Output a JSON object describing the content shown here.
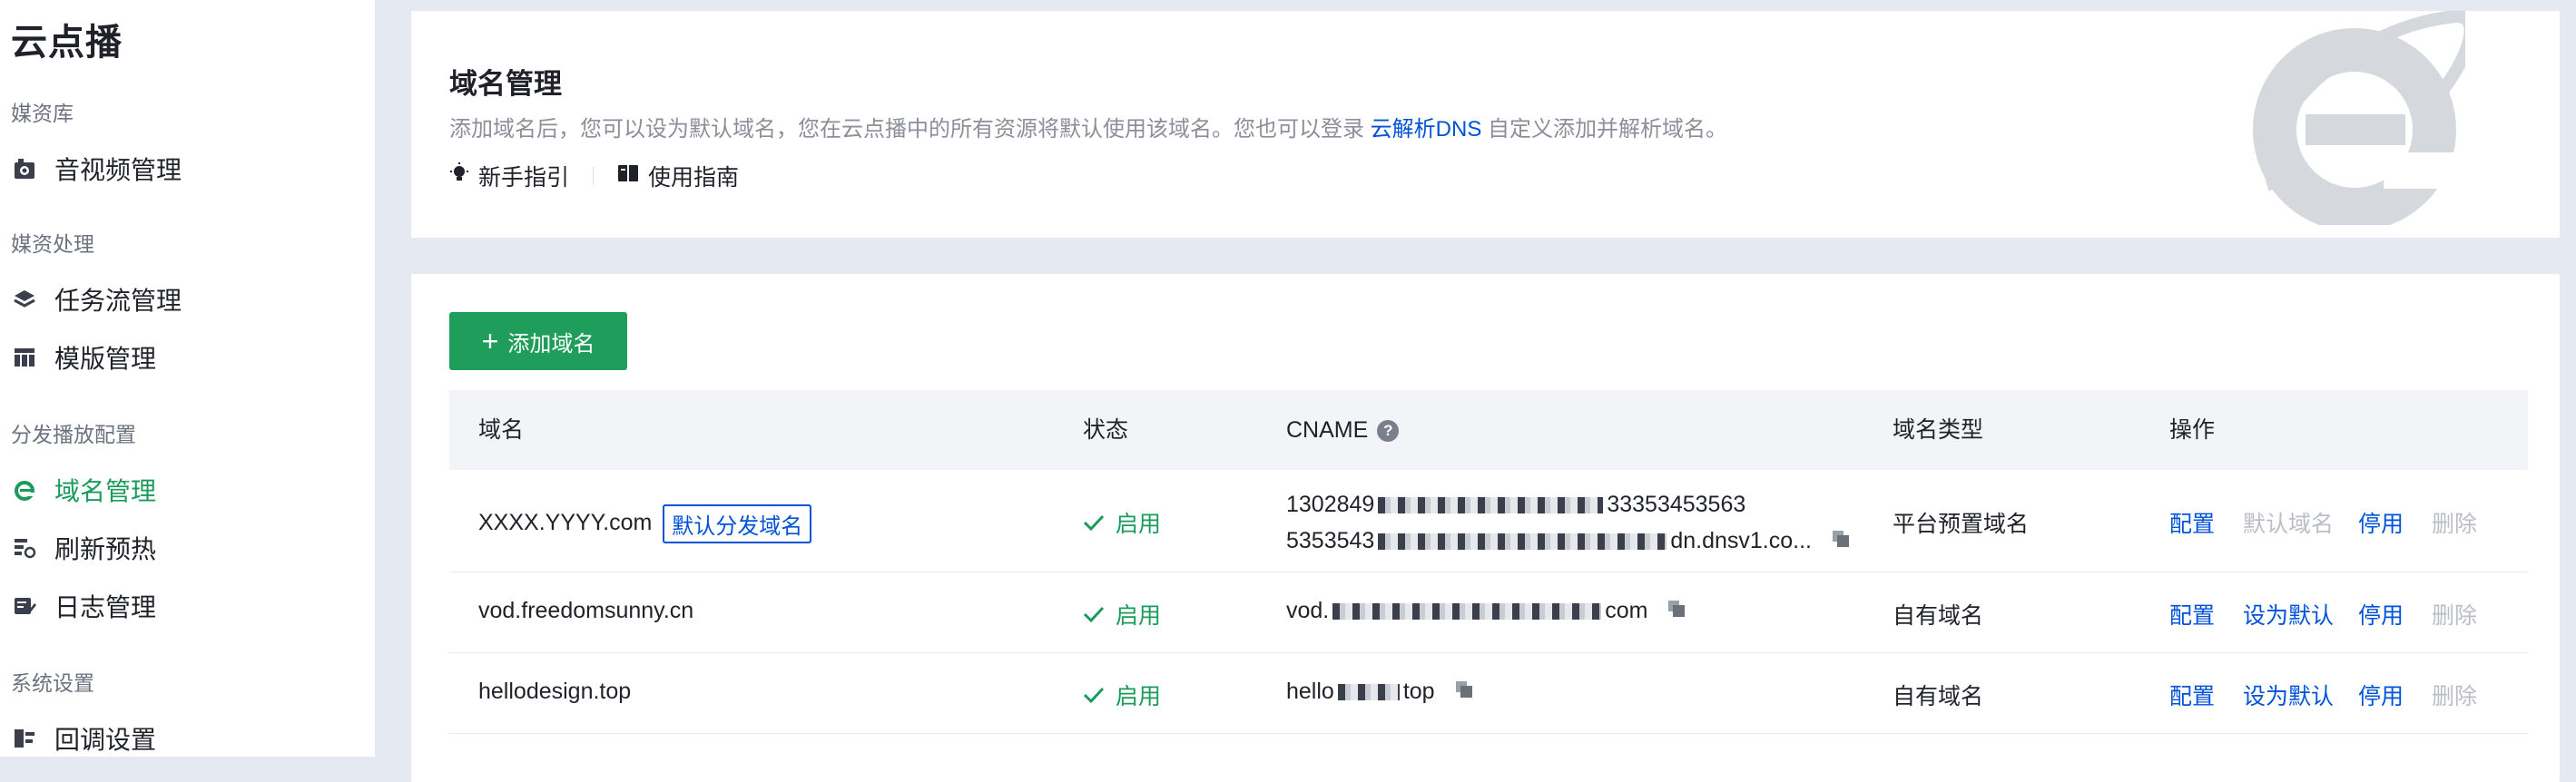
{
  "brand": "云点播",
  "sidebar": {
    "groups": [
      {
        "title": "媒资库",
        "items": [
          {
            "label": "音视频管理",
            "icon": "video-file-icon"
          }
        ]
      },
      {
        "title": "媒资处理",
        "items": [
          {
            "label": "任务流管理",
            "icon": "layers-icon"
          },
          {
            "label": "模版管理",
            "icon": "table-icon"
          }
        ]
      },
      {
        "title": "分发播放配置",
        "items": [
          {
            "label": "域名管理",
            "icon": "ie-icon",
            "active": true
          },
          {
            "label": "刷新预热",
            "icon": "refresh-list-icon"
          },
          {
            "label": "日志管理",
            "icon": "log-icon"
          }
        ]
      },
      {
        "title": "系统设置",
        "items": [
          {
            "label": "回调设置",
            "icon": "callback-icon"
          }
        ]
      }
    ]
  },
  "header": {
    "title": "域名管理",
    "desc_before": "添加域名后，您可以设为默认域名，您在云点播中的所有资源将默认使用该域名。您也可以登录 ",
    "desc_link": "云解析DNS",
    "desc_after": " 自定义添加并解析域名。",
    "guide": "新手指引",
    "manual": "使用指南"
  },
  "toolbar": {
    "add_label": "添加域名"
  },
  "table": {
    "columns": [
      "域名",
      "状态",
      "CNAME",
      "域名类型",
      "操作"
    ],
    "rows": [
      {
        "domain": "XXXX.YYYY.com",
        "badge": "默认分发域名",
        "status": "启用",
        "cname_line1_prefix": "1302849",
        "cname_line1_suffix": "33353453563",
        "cname_line2_prefix": "5353543",
        "cname_line2_suffix": "dn.dnsv1.co...",
        "type": "平台预置域名",
        "ops": [
          "配置",
          "默认域名",
          "停用",
          "删除"
        ]
      },
      {
        "domain": "vod.freedomsunny.cn",
        "status": "启用",
        "cname_prefix": "vod.",
        "cname_suffix": "com",
        "type": "自有域名",
        "ops": [
          "配置",
          "设为默认",
          "停用",
          "删除"
        ]
      },
      {
        "domain": "hellodesign.top",
        "status": "启用",
        "cname_prefix": "hello",
        "cname_suffix": "top",
        "type": "自有域名",
        "ops": [
          "配置",
          "设为默认",
          "停用",
          "删除"
        ]
      }
    ]
  },
  "colors": {
    "accent_green": "#1f9d5a",
    "link_blue": "#0052d9",
    "disabled_gray": "#b9bec7",
    "page_bg": "#e5eaf2"
  }
}
